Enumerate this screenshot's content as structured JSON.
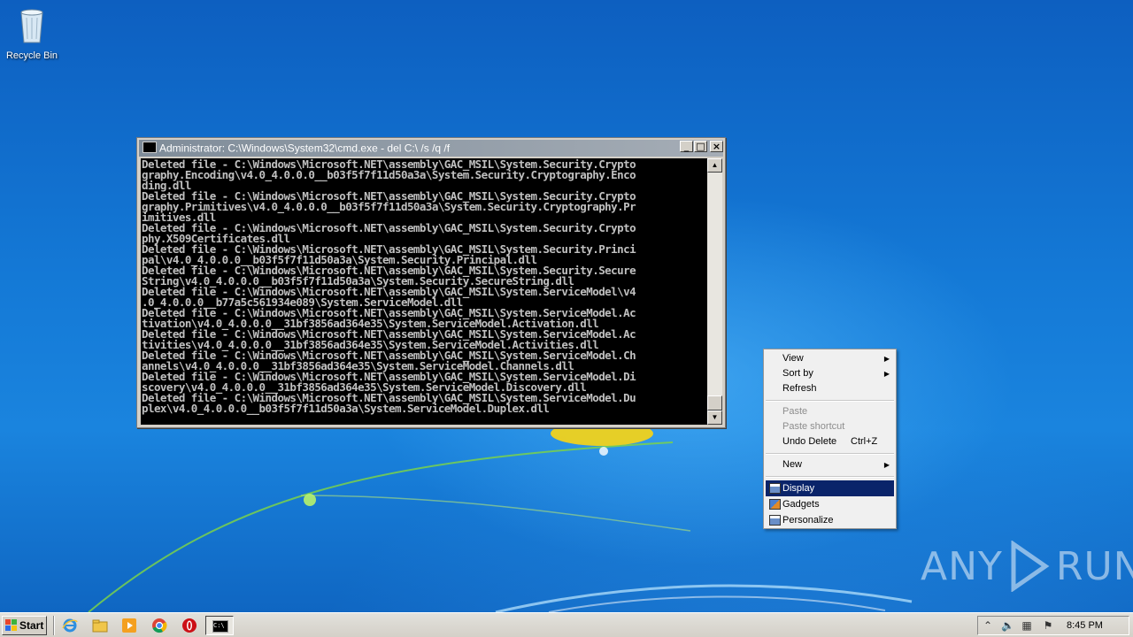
{
  "desktop": {
    "icons": [
      {
        "label": "Recycle Bin"
      }
    ]
  },
  "cmd_window": {
    "title": "Administrator: C:\\Windows\\System32\\cmd.exe - del  C:\\ /s /q /f",
    "lines": [
      "Deleted file - C:\\Windows\\Microsoft.NET\\assembly\\GAC_MSIL\\System.Security.Crypto",
      "graphy.Encoding\\v4.0_4.0.0.0__b03f5f7f11d50a3a\\System.Security.Cryptography.Enco",
      "ding.dll",
      "Deleted file - C:\\Windows\\Microsoft.NET\\assembly\\GAC_MSIL\\System.Security.Crypto",
      "graphy.Primitives\\v4.0_4.0.0.0__b03f5f7f11d50a3a\\System.Security.Cryptography.Pr",
      "imitives.dll",
      "Deleted file - C:\\Windows\\Microsoft.NET\\assembly\\GAC_MSIL\\System.Security.Crypto",
      "phy.X509Certificates.dll",
      "Deleted file - C:\\Windows\\Microsoft.NET\\assembly\\GAC_MSIL\\System.Security.Princi",
      "pal\\v4.0_4.0.0.0__b03f5f7f11d50a3a\\System.Security.Principal.dll",
      "Deleted file - C:\\Windows\\Microsoft.NET\\assembly\\GAC_MSIL\\System.Security.Secure",
      "String\\v4.0_4.0.0.0__b03f5f7f11d50a3a\\System.Security.SecureString.dll",
      "Deleted file - C:\\Windows\\Microsoft.NET\\assembly\\GAC_MSIL\\System.ServiceModel\\v4",
      ".0_4.0.0.0__b77a5c561934e089\\System.ServiceModel.dll",
      "Deleted file - C:\\Windows\\Microsoft.NET\\assembly\\GAC_MSIL\\System.ServiceModel.Ac",
      "tivation\\v4.0_4.0.0.0__31bf3856ad364e35\\System.ServiceModel.Activation.dll",
      "Deleted file - C:\\Windows\\Microsoft.NET\\assembly\\GAC_MSIL\\System.ServiceModel.Ac",
      "tivities\\v4.0_4.0.0.0__31bf3856ad364e35\\System.ServiceModel.Activities.dll",
      "Deleted file - C:\\Windows\\Microsoft.NET\\assembly\\GAC_MSIL\\System.ServiceModel.Ch",
      "annels\\v4.0_4.0.0.0__31bf3856ad364e35\\System.ServiceModel.Channels.dll",
      "Deleted file - C:\\Windows\\Microsoft.NET\\assembly\\GAC_MSIL\\System.ServiceModel.Di",
      "scovery\\v4.0_4.0.0.0__31bf3856ad364e35\\System.ServiceModel.Discovery.dll",
      "Deleted file - C:\\Windows\\Microsoft.NET\\assembly\\GAC_MSIL\\System.ServiceModel.Du",
      "plex\\v4.0_4.0.0.0__b03f5f7f11d50a3a\\System.ServiceModel.Duplex.dll"
    ],
    "buttons": {
      "minimize": "_",
      "maximize": "□",
      "close": "×"
    }
  },
  "context_menu": {
    "view": "View",
    "sort_by": "Sort by",
    "refresh": "Refresh",
    "paste": "Paste",
    "paste_shortcut": "Paste shortcut",
    "undo_delete": "Undo Delete",
    "undo_shortcut": "Ctrl+Z",
    "new": "New",
    "display": "Display",
    "gadgets": "Gadgets",
    "personalize": "Personalize"
  },
  "watermark": {
    "text": "ANY RUN"
  },
  "taskbar": {
    "start_label": "Start",
    "quick_launch": [
      "internet-explorer-icon",
      "explorer-folder-icon",
      "media-player-icon",
      "chrome-icon",
      "opera-icon"
    ],
    "clock": "8:45 PM"
  },
  "colors": {
    "desktop_blue": "#1479d6",
    "menu_highlight": "#0a246a",
    "console_bg": "#000000",
    "console_text": "#c0c0c0"
  }
}
